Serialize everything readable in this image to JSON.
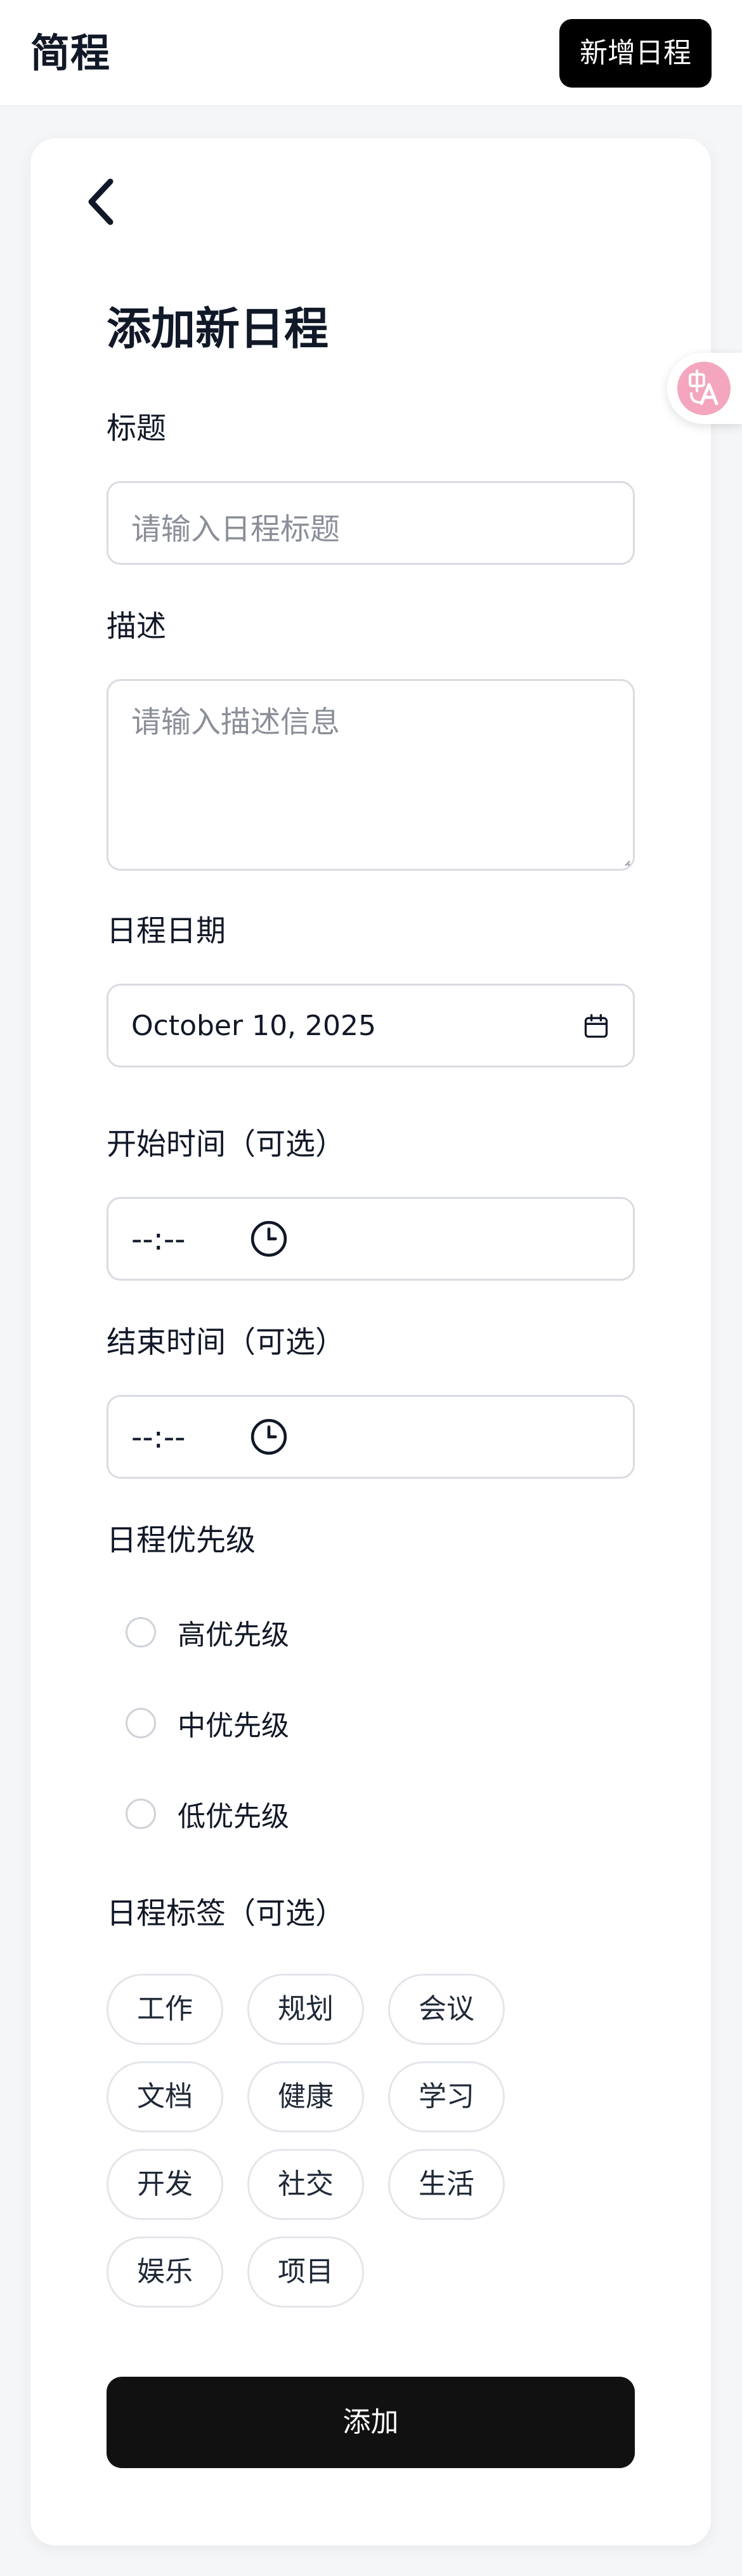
{
  "header": {
    "app_title": "简程",
    "new_button": "新增日程"
  },
  "form": {
    "title": "添加新日程",
    "title_field": {
      "label": "标题",
      "placeholder": "请输入日程标题"
    },
    "description_field": {
      "label": "描述",
      "placeholder": "请输入描述信息"
    },
    "date_field": {
      "label": "日程日期",
      "value": "October 10, 2025"
    },
    "start_time_field": {
      "label": "开始时间（可选）",
      "value": "--:--"
    },
    "end_time_field": {
      "label": "结束时间（可选）",
      "value": "--:--"
    },
    "priority": {
      "label": "日程优先级",
      "options": [
        "高优先级",
        "中优先级",
        "低优先级"
      ]
    },
    "tags": {
      "label": "日程标签（可选）",
      "items": [
        "工作",
        "规划",
        "会议",
        "文档",
        "健康",
        "学习",
        "开发",
        "社交",
        "生活",
        "娱乐",
        "项目"
      ]
    },
    "submit_label": "添加"
  },
  "colors": {
    "primary_button": "#000000",
    "submit_button": "#111111",
    "translate_badge": "#f3a6bd"
  },
  "icons": {
    "back": "chevron-left-icon",
    "date": "calendar-icon",
    "time": "clock-icon",
    "translate": "translate-icon"
  }
}
